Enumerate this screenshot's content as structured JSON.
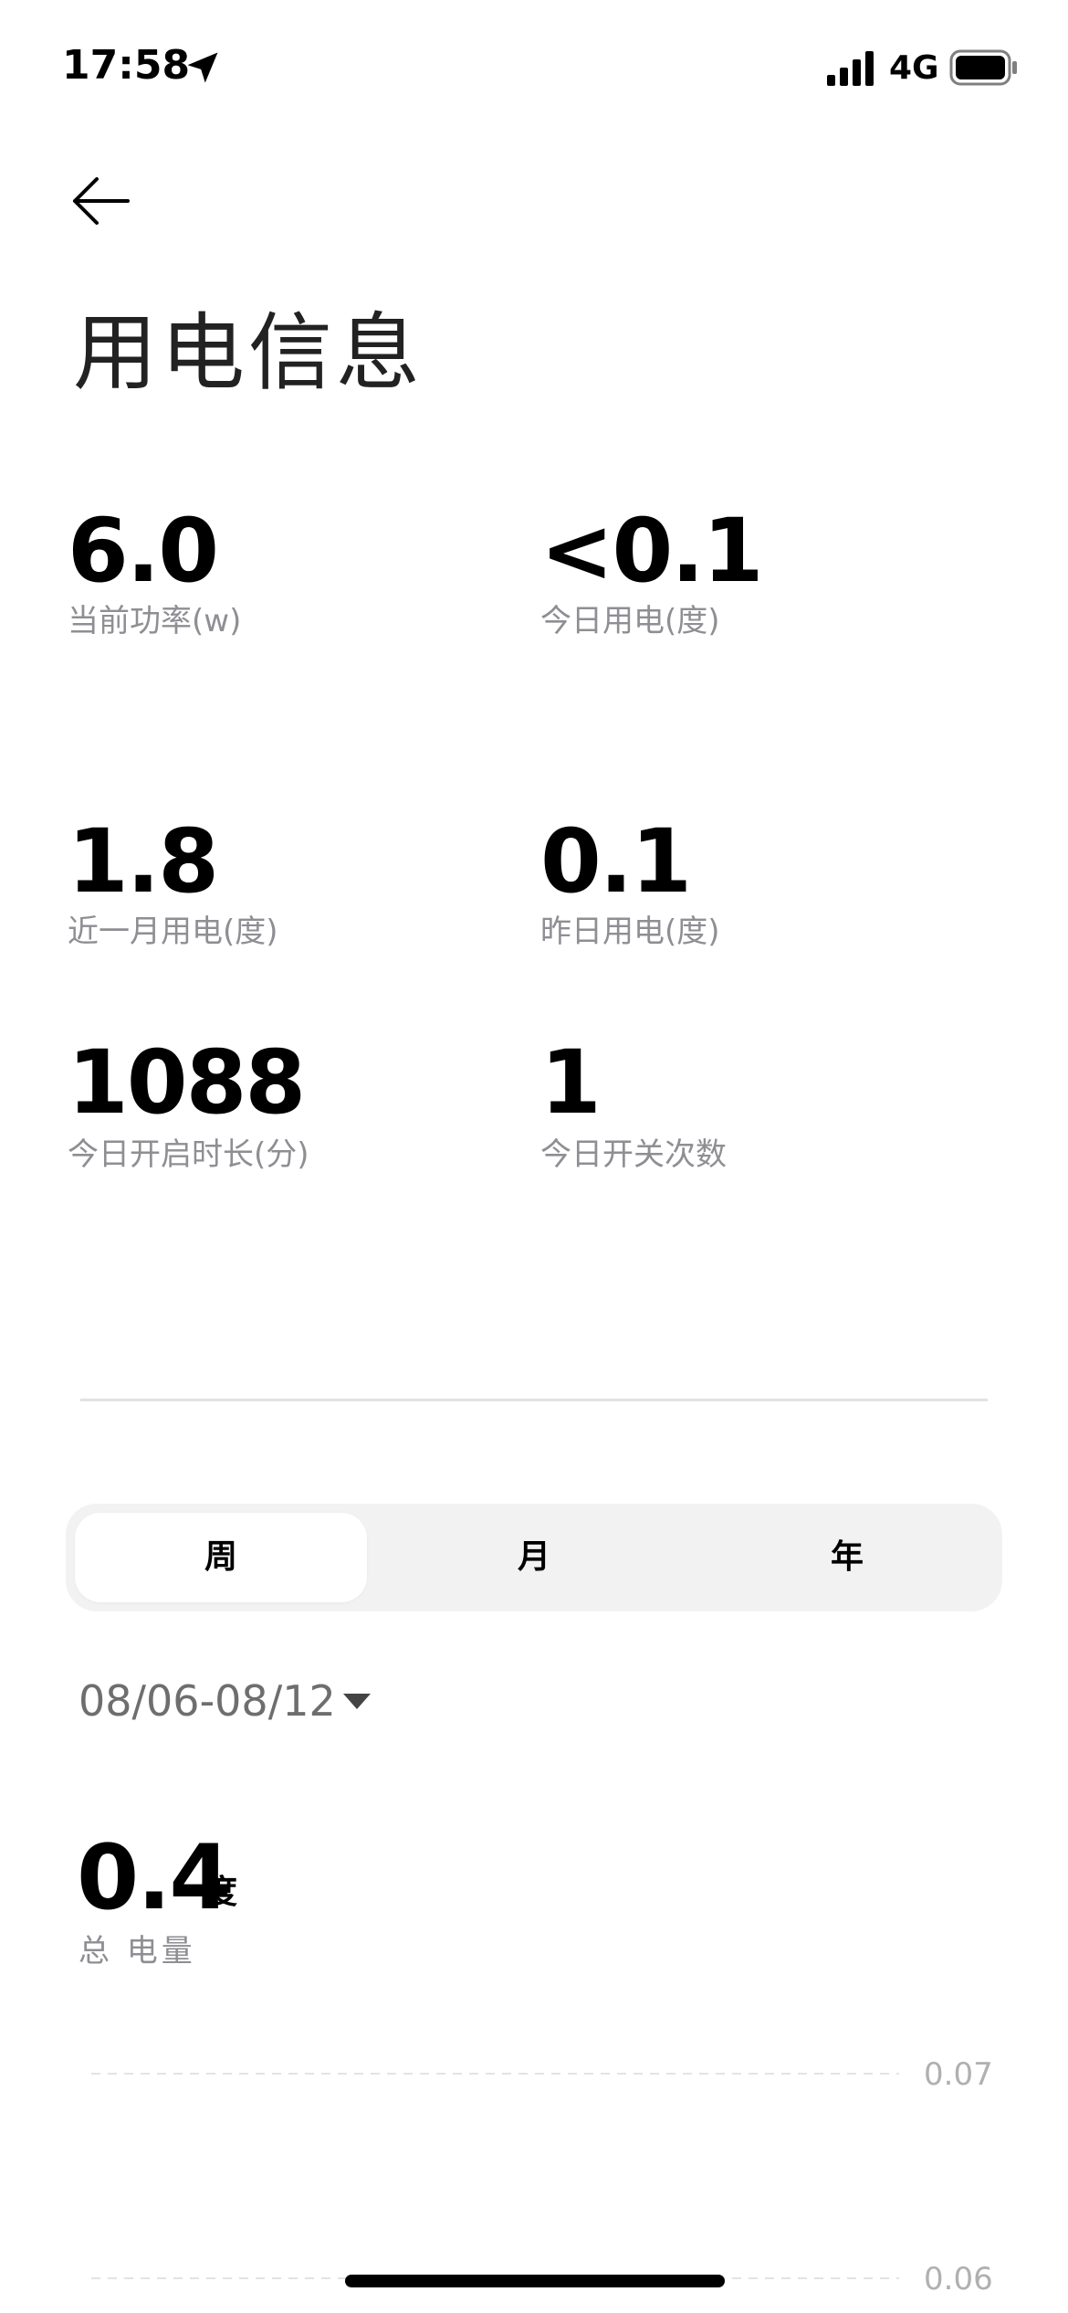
{
  "status_bar": {
    "time": "17:58",
    "network": "4G",
    "icons": [
      "location-arrow-icon",
      "cellular-signal-icon",
      "battery-icon"
    ]
  },
  "header": {
    "back_icon": "arrow-left-icon",
    "title": "用电信息"
  },
  "stats": [
    {
      "value": "6.0",
      "label": "当前功率(w)"
    },
    {
      "value": "<0.1",
      "label": "今日用电(度)"
    },
    {
      "value": "1.8",
      "label": "近一月用电(度)"
    },
    {
      "value": "0.1",
      "label": "昨日用电(度)"
    },
    {
      "value": "1088",
      "label": "今日开启时长(分)"
    },
    {
      "value": "1",
      "label": "今日开关次数"
    }
  ],
  "period_tabs": {
    "items": [
      "周",
      "月",
      "年"
    ],
    "selected": "周"
  },
  "date_range": {
    "value": "08/06-08/12",
    "icon": "caret-down-icon"
  },
  "total": {
    "value": "0.4",
    "unit": "度",
    "label": "总 电量"
  },
  "chart_data": {
    "type": "bar",
    "title": "",
    "xlabel": "",
    "ylabel": "",
    "y_ticks": [
      "0.07",
      "0.06"
    ],
    "grid": true,
    "grid_style": "dashed",
    "series": []
  },
  "colors": {
    "background": "#ffffff",
    "text_primary": "#000000",
    "text_secondary": "#8e8e93",
    "segment_bg": "#f2f2f2",
    "segment_active": "#ffffff",
    "divider": "#e2e2e2"
  }
}
